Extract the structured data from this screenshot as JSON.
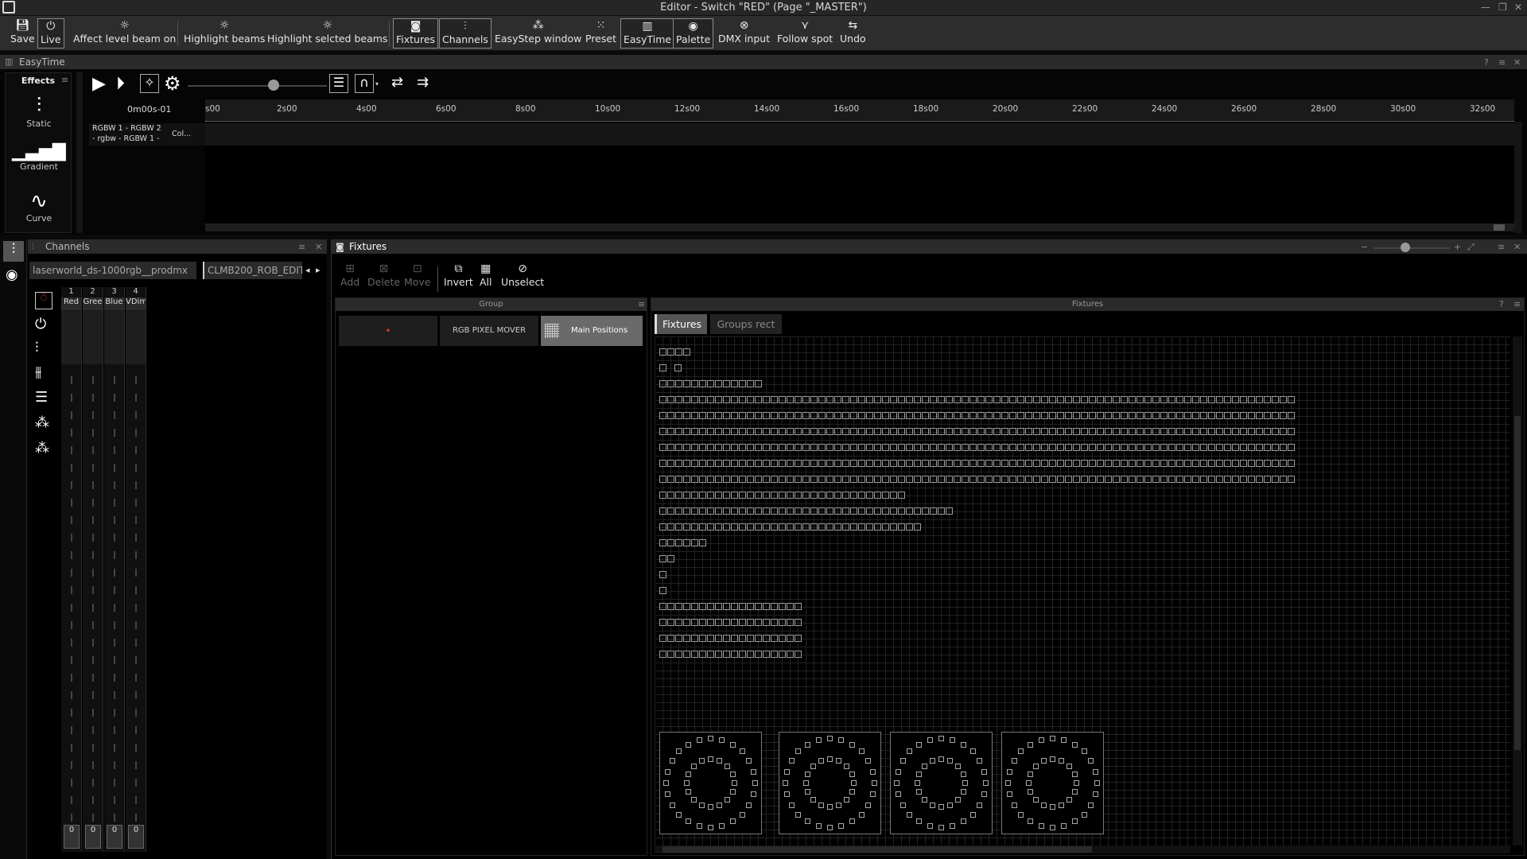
{
  "window": {
    "title": "Editor - Switch \"RED\" (Page \"_MASTER\")"
  },
  "toolbar": {
    "save": "Save",
    "live": "Live",
    "affect": "Affect level beam on",
    "highlight_beams": "Highlight beams",
    "highlight_selected": "Highlight selcted beams",
    "fixtures": "Fixtures",
    "channels": "Channels",
    "easystep": "EasyStep window",
    "preset": "Preset",
    "easytime": "EasyTime",
    "palette": "Palette",
    "dmx_input": "DMX input",
    "follow_spot": "Follow spot",
    "undo": "Undo"
  },
  "easytime": {
    "title": "EasyTime",
    "effects_tab": "Effects",
    "effects": [
      {
        "label": "Static",
        "icon": "sliders-icon"
      },
      {
        "label": "Gradient",
        "icon": "bars-icon"
      },
      {
        "label": "Curve",
        "icon": "wave-icon"
      }
    ],
    "time_display": "0m00s-01",
    "ruler": [
      "s00",
      "2s00",
      "4s00",
      "6s00",
      "8s00",
      "10s00",
      "12s00",
      "14s00",
      "16s00",
      "18s00",
      "20s00",
      "22s00",
      "24s00",
      "26s00",
      "28s00",
      "30s00",
      "32s00"
    ],
    "track_line1": "RGBW   1 - RGBW   2",
    "track_line2": "- rgbw - RGBW   1 -",
    "track_col": "Col..."
  },
  "channels": {
    "title": "Channels",
    "tab1": "laserworld_ds-1000rgb__prodmx",
    "tab2": "CLMB200_ROB_EDIT",
    "columns": [
      {
        "num": "1",
        "name": "Red",
        "value": "0"
      },
      {
        "num": "2",
        "name": "Gree",
        "value": "0"
      },
      {
        "num": "3",
        "name": "Blue",
        "value": "0"
      },
      {
        "num": "4",
        "name": "VDim",
        "value": "0"
      }
    ]
  },
  "fixtures": {
    "title": "Fixtures",
    "actions": {
      "add": "Add",
      "delete": "Delete",
      "move": "Move",
      "invert": "Invert",
      "all": "All",
      "unselect": "Unselect"
    },
    "group_header": "Group",
    "fixtures_header": "Fixtures",
    "groups": [
      {
        "label": "",
        "dot": "•"
      },
      {
        "label": "RGB PIXEL MOVER"
      },
      {
        "label": "Main Positions"
      }
    ],
    "tab_fixtures": "Fixtures",
    "tab_groups_rect": "Groups rect",
    "rows": [
      4,
      2,
      13,
      80,
      80,
      80,
      80,
      80,
      80,
      31,
      37,
      33,
      6,
      2,
      1,
      1,
      18,
      18,
      18,
      18
    ]
  }
}
